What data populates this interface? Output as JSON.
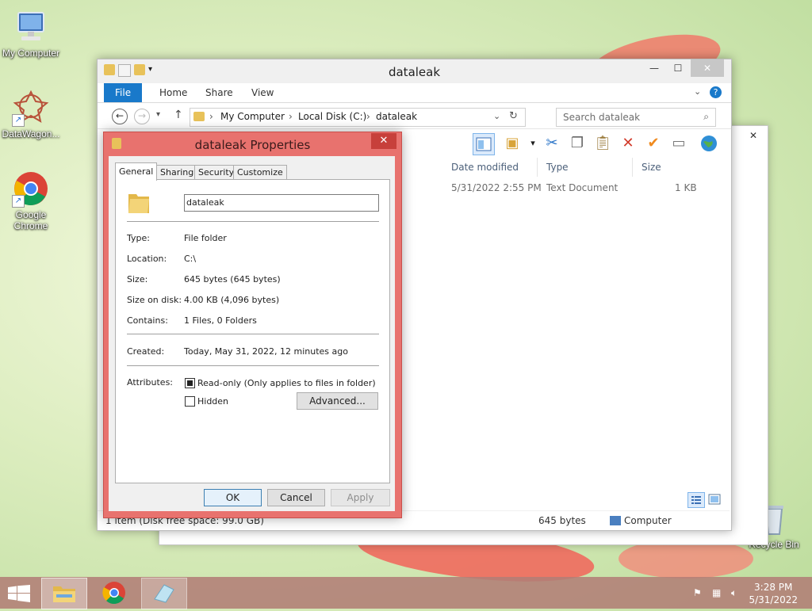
{
  "desktop": {
    "icons": [
      {
        "label": "My Computer"
      },
      {
        "label": "DataWagon..."
      },
      {
        "label": "Google\nChrome"
      },
      {
        "label": "Recycle Bin"
      }
    ]
  },
  "explorer": {
    "title": "dataleak",
    "window_buttons": {
      "minimize": "—",
      "maximize": "☐",
      "close": "✕"
    },
    "ribbon_tabs": [
      "File",
      "Home",
      "Share",
      "View"
    ],
    "address": {
      "crumbs": [
        "My Computer",
        "Local Disk (C:)",
        "dataleak"
      ]
    },
    "search": {
      "placeholder": "Search dataleak"
    },
    "columns": [
      "Date modified",
      "Type",
      "Size"
    ],
    "rows": [
      {
        "date_modified": "5/31/2022 2:55 PM",
        "type": "Text Document",
        "size": "1 KB"
      }
    ],
    "status": {
      "items": "1 item (Disk free space: 99.0 GB)",
      "size": "645 bytes",
      "location": "Computer"
    }
  },
  "dialog": {
    "title": "dataleak Properties",
    "close": "✕",
    "tabs": [
      "General",
      "Sharing",
      "Security",
      "Customize"
    ],
    "name": "dataleak",
    "fields": {
      "type": {
        "label": "Type:",
        "value": "File folder"
      },
      "location": {
        "label": "Location:",
        "value": "C:\\"
      },
      "size": {
        "label": "Size:",
        "value": "645 bytes (645 bytes)"
      },
      "size_on_disk": {
        "label": "Size on disk:",
        "value": "4.00 KB (4,096 bytes)"
      },
      "contains": {
        "label": "Contains:",
        "value": "1 Files, 0 Folders"
      },
      "created": {
        "label": "Created:",
        "value": "Today, May 31, 2022, 12 minutes ago"
      }
    },
    "attributes": {
      "label": "Attributes:",
      "readonly": {
        "label": "Read-only (Only applies to files in folder)",
        "checked": true
      },
      "hidden": {
        "label": "Hidden",
        "checked": false
      },
      "advanced": "Advanced..."
    },
    "buttons": {
      "ok": "OK",
      "cancel": "Cancel",
      "apply": "Apply"
    }
  },
  "taskbar": {
    "clock": {
      "time": "3:28 PM",
      "date": "5/31/2022"
    }
  },
  "colors": {
    "accent": "#1979ca",
    "dialog_frame": "#e8726e",
    "close_red": "#c7403b"
  }
}
